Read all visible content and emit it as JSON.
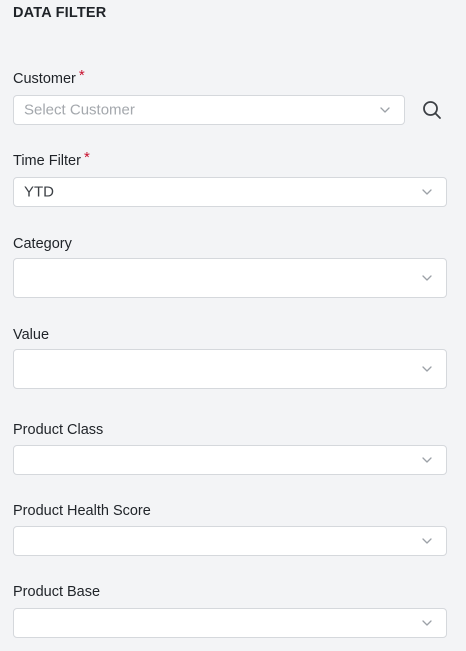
{
  "panel": {
    "title": "DATA FILTER"
  },
  "fields": {
    "customer": {
      "label": "Customer",
      "required_mark": "*",
      "placeholder": "Select Customer"
    },
    "time_filter": {
      "label": "Time Filter",
      "required_mark": "*",
      "value": "YTD"
    },
    "category": {
      "label": "Category",
      "value": ""
    },
    "value": {
      "label": "Value",
      "value": ""
    },
    "product_class": {
      "label": "Product Class",
      "value": ""
    },
    "product_health_score": {
      "label": "Product Health Score",
      "value": ""
    },
    "product_base": {
      "label": "Product Base",
      "value": ""
    }
  },
  "icons": {
    "search": "search-icon",
    "dropdown": "chevron-down-icon"
  },
  "colors": {
    "background": "#f3f4f6",
    "required": "#c8102e",
    "placeholder": "#a4a8ad",
    "border": "#d5d8dc"
  }
}
